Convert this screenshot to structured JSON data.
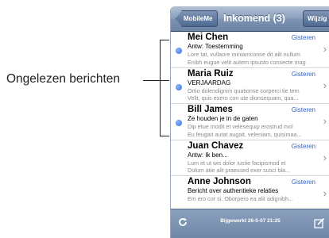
{
  "callout": {
    "label": "Ongelezen berichten"
  },
  "navbar": {
    "back_label": "MobileMe",
    "title": "Inkomend (3)",
    "edit_label": "Wijzig"
  },
  "messages": [
    {
      "sender": "Mei Chen",
      "time": "Gisteren",
      "subject": "Antw: Toestemming",
      "preview": [
        "Lore tat, vullaore miniamconse dit alit nullum",
        "Enibh eugue velit autem ipsusto consecte mag"
      ],
      "unread": true
    },
    {
      "sender": "Maria Ruiz",
      "time": "Gisteren",
      "subject": "VERJAARDAG",
      "preview": [
        "Ortio dolendignim quationse corperci tie tem",
        "Velit, quis exero con ute dionsequam, qua..."
      ],
      "unread": true
    },
    {
      "sender": "Bill James",
      "time": "Gisteren",
      "subject": "Ze houden je in de gaten",
      "preview": [
        "Dip etue modit et velesequip erostrud mol",
        "Eu feugait autat augait, veleniam, quisimaa..."
      ],
      "unread": true
    },
    {
      "sender": "Juan Chavez",
      "time": "Gisteren",
      "subject": "Antw: Ik ben...",
      "preview": [
        "Lum et ut wis dolor iustie facipismod et",
        "Dolum atie alit praessed exer susci bla..."
      ],
      "unread": false
    },
    {
      "sender": "Anne Johnson",
      "time": "Gisteren",
      "subject": "Bericht over authentieke relaties",
      "preview": [
        "Em ero cor si. Oborpero ea alit adignibh..."
      ],
      "unread": false
    }
  ],
  "toolbar": {
    "updated_text": "Bijgewerkt 26-5-07 21:25"
  },
  "colors": {
    "unread_dot": "#2f6fe6",
    "time_text": "#2a62d8",
    "navbar": "#8aa0bd"
  },
  "icons": {
    "refresh": "refresh-icon",
    "compose": "compose-icon",
    "chevron": "chevron-right-icon"
  }
}
